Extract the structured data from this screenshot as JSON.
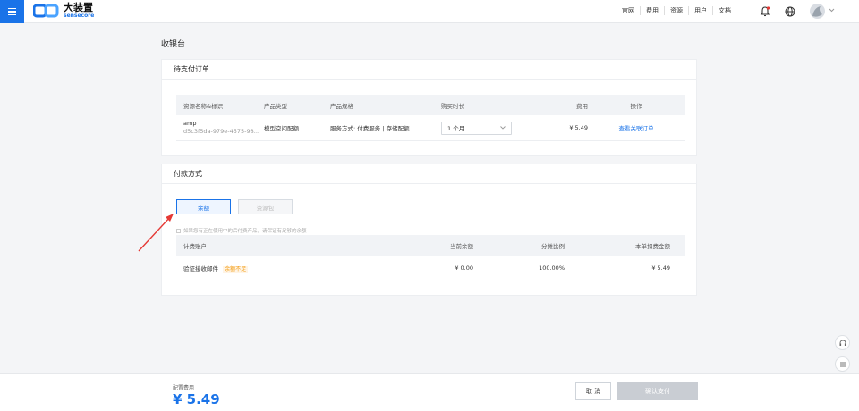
{
  "topbar": {
    "logo_main": "大装置",
    "logo_sub": "sensecore",
    "nav": [
      "官网",
      "费用",
      "资源",
      "用户",
      "文档"
    ]
  },
  "page": {
    "title": "收银台"
  },
  "order_card": {
    "title": "待支付订单",
    "columns": [
      "资源名称&标识",
      "产品类型",
      "产品规格",
      "购买时长",
      "费用",
      "操作"
    ],
    "row": {
      "name": "amp",
      "id": "d5c3f5da-979e-4575-98...",
      "product_type": "模型空间配额",
      "spec": "服务方式: 付费服务 | 存储配额...",
      "duration": "1 个月",
      "fee": "¥ 5.49",
      "action": "查看关联订单"
    }
  },
  "pay_card": {
    "title": "付款方式",
    "tabs": [
      {
        "label": "余额",
        "active": true
      },
      {
        "label": "资源包",
        "active": false
      }
    ],
    "note": "如果您有正在使用中的后付费产品，请保证有足够的余额",
    "columns": [
      "计费账户",
      "当前余额",
      "分摊比例",
      "本单扣费金额"
    ],
    "row": {
      "account": "验证接收邮件",
      "badge": "余额不足",
      "balance": "¥ 0.00",
      "ratio": "100.00%",
      "deduct": "¥ 5.49"
    }
  },
  "footer": {
    "fee_label": "配置费用",
    "fee_value": "¥ 5.49",
    "cancel": "取 消",
    "confirm": "确认支付"
  },
  "colors": {
    "accent": "#1a73e8",
    "warning": "#f39c12",
    "arrow": "#e53935"
  }
}
